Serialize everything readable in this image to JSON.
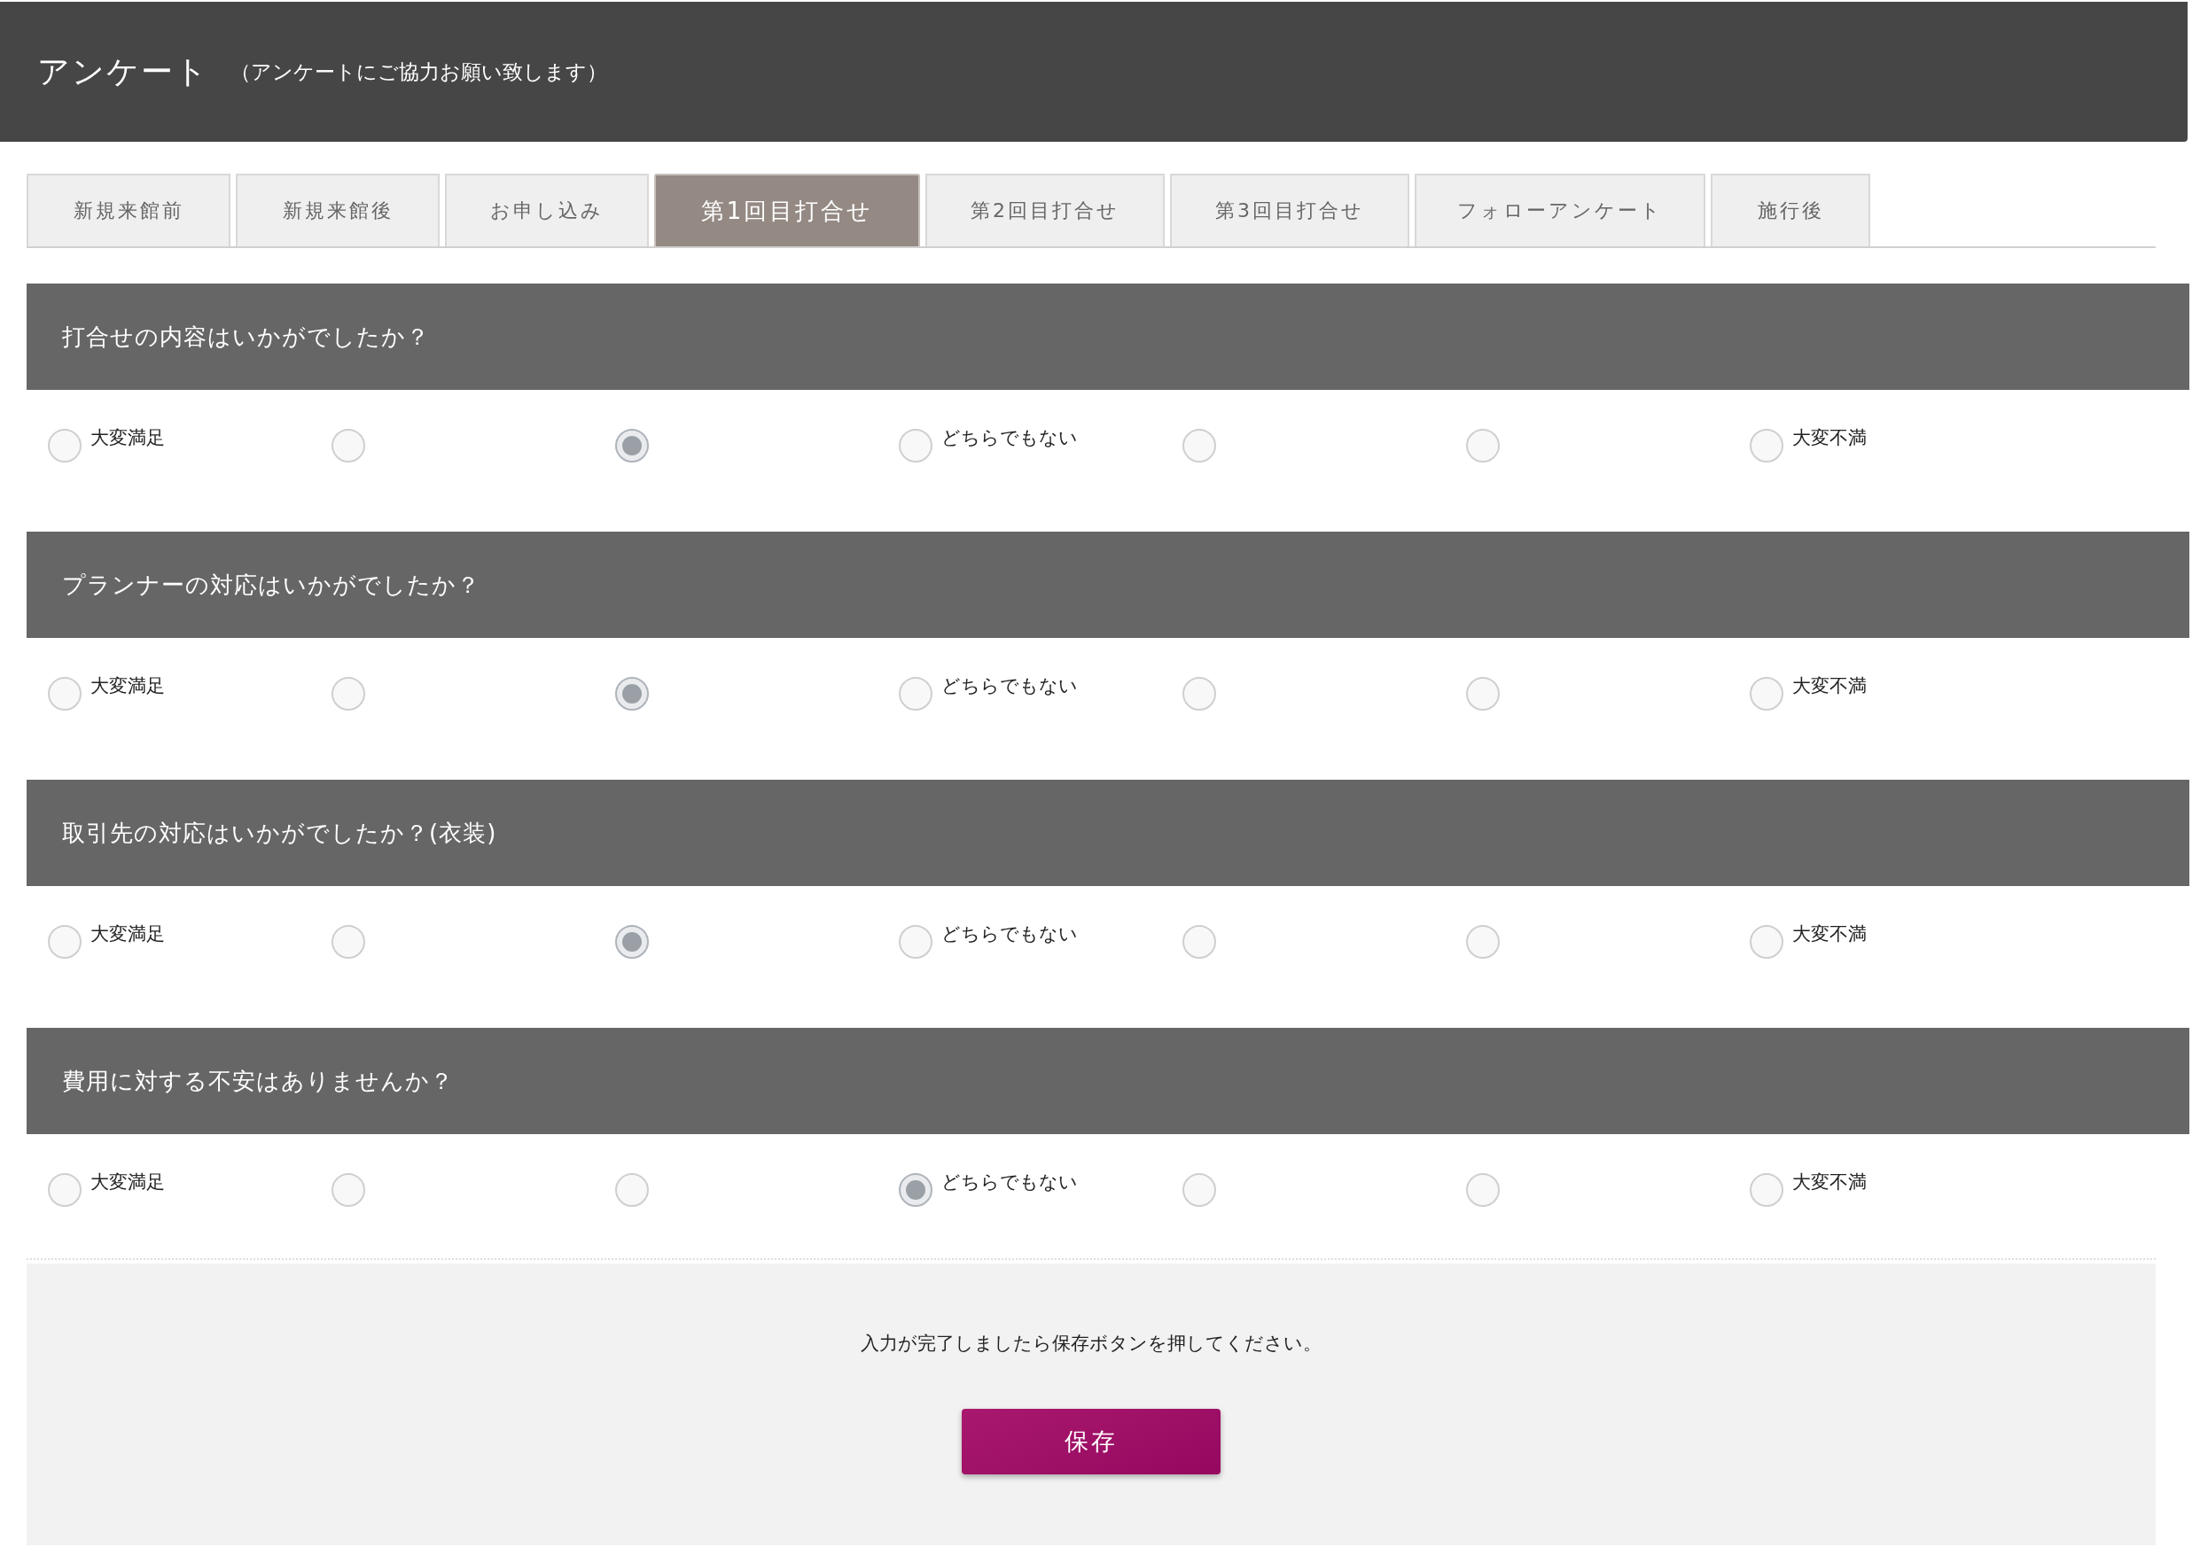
{
  "header": {
    "title": "アンケート",
    "subtitle": "（アンケートにご協力お願い致します）"
  },
  "tabs": [
    {
      "label": "新規来館前",
      "selected": false
    },
    {
      "label": "新規来館後",
      "selected": false
    },
    {
      "label": "お申し込み",
      "selected": false
    },
    {
      "label": "第1回目打合せ",
      "selected": true
    },
    {
      "label": "第2回目打合せ",
      "selected": false
    },
    {
      "label": "第3回目打合せ",
      "selected": false
    },
    {
      "label": "フォローアンケート",
      "selected": false
    },
    {
      "label": "施行後",
      "selected": false
    }
  ],
  "questions": [
    {
      "title": "打合せの内容はいかがでしたか？",
      "options": [
        {
          "label": "大変満足",
          "selected": false
        },
        {
          "selected": false
        },
        {
          "selected": true
        },
        {
          "label": "どちらでもない",
          "selected": false
        },
        {
          "selected": false
        },
        {
          "selected": false
        },
        {
          "label": "大変不満",
          "selected": false
        }
      ]
    },
    {
      "title": "プランナーの対応はいかがでしたか？",
      "options": [
        {
          "label": "大変満足",
          "selected": false
        },
        {
          "selected": false
        },
        {
          "selected": true
        },
        {
          "label": "どちらでもない",
          "selected": false
        },
        {
          "selected": false
        },
        {
          "selected": false
        },
        {
          "label": "大変不満",
          "selected": false
        }
      ]
    },
    {
      "title": "取引先の対応はいかがでしたか？(衣装)",
      "options": [
        {
          "label": "大変満足",
          "selected": false
        },
        {
          "selected": false
        },
        {
          "selected": true
        },
        {
          "label": "どちらでもない",
          "selected": false
        },
        {
          "selected": false
        },
        {
          "selected": false
        },
        {
          "label": "大変不満",
          "selected": false
        }
      ]
    },
    {
      "title": "費用に対する不安はありませんか？",
      "options": [
        {
          "label": "大変満足",
          "selected": false
        },
        {
          "selected": false
        },
        {
          "selected": false
        },
        {
          "label": "どちらでもない",
          "selected": true
        },
        {
          "selected": false
        },
        {
          "selected": false
        },
        {
          "label": "大変不満",
          "selected": false
        }
      ]
    }
  ],
  "footer": {
    "message": "入力が完了しましたら保存ボタンを押してください。",
    "save_button": "保存"
  }
}
